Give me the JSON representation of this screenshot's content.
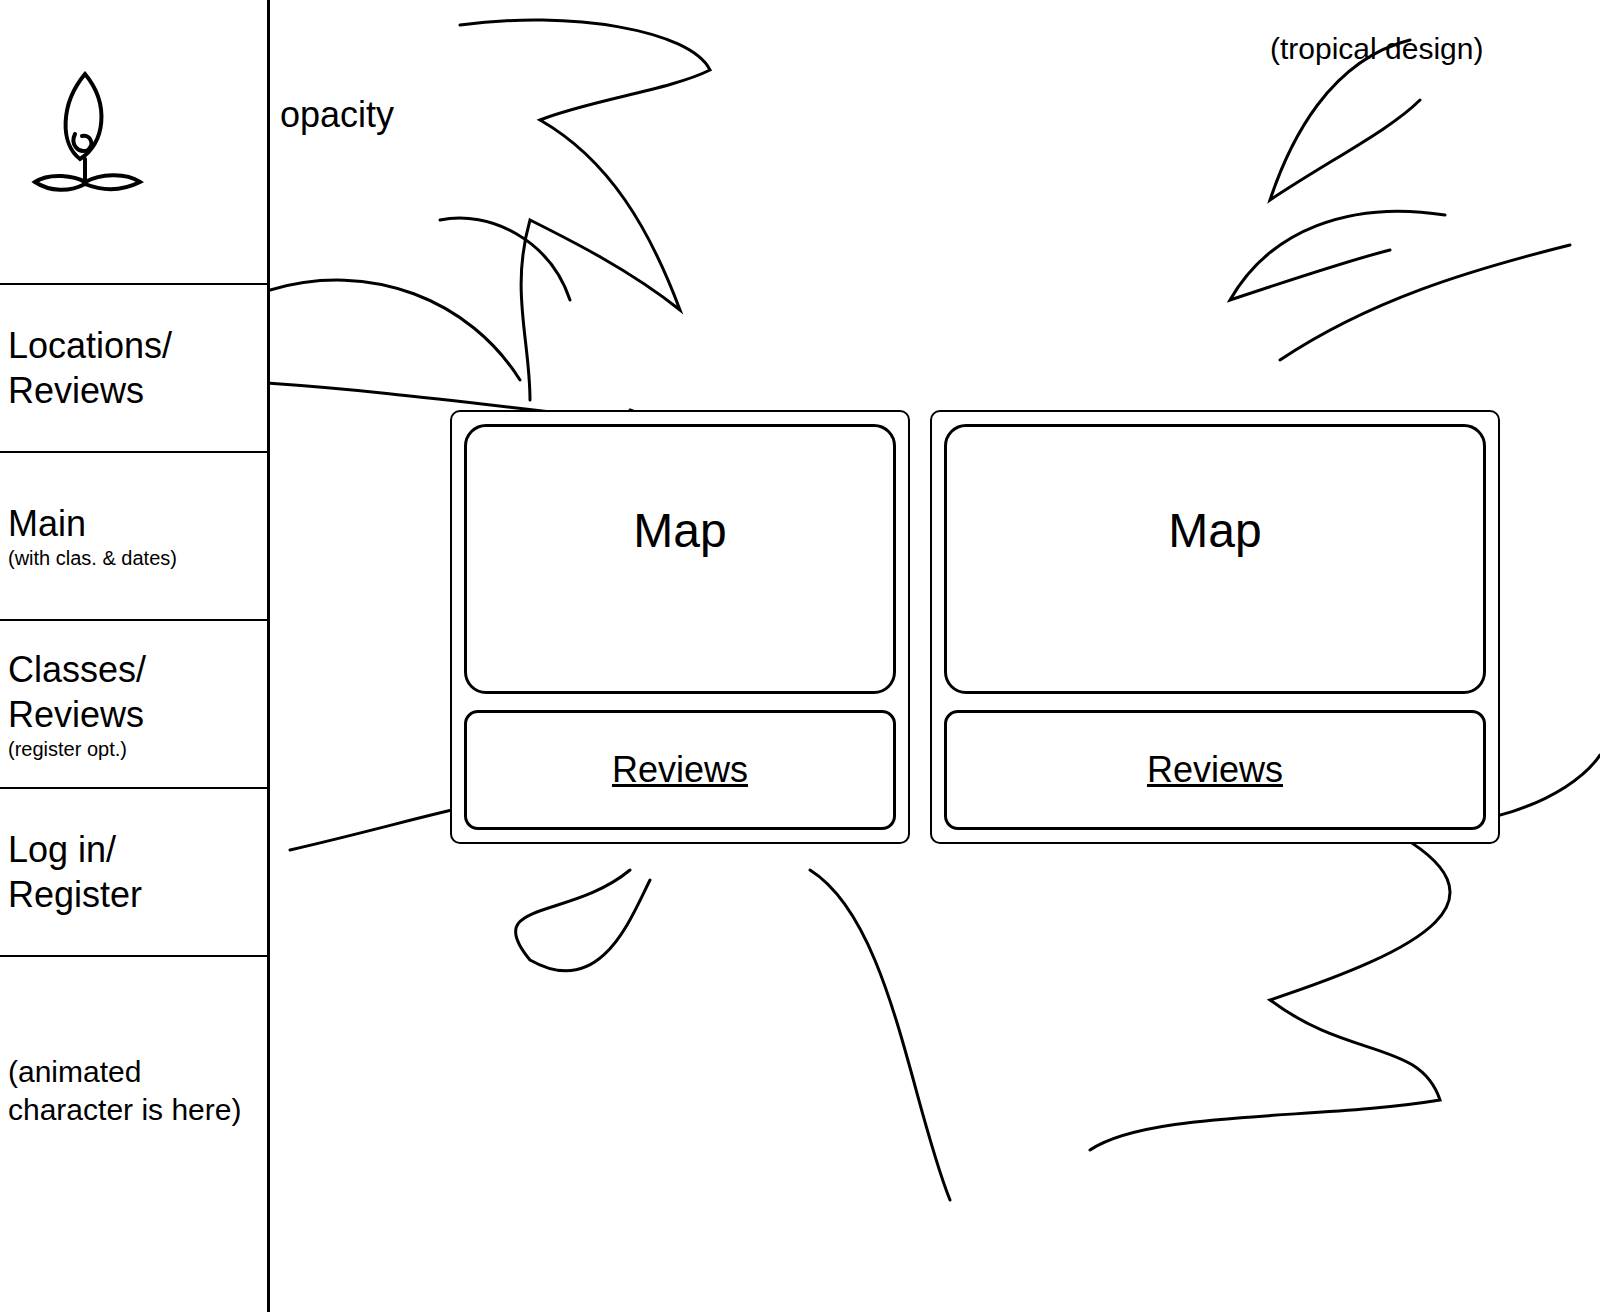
{
  "sidebar": {
    "items": [
      {
        "label": "Locations/ Reviews",
        "note": ""
      },
      {
        "label": "Main",
        "note": "(with clas. & dates)"
      },
      {
        "label": "Classes/ Reviews",
        "note": "(register opt.)"
      },
      {
        "label": "Log in/ Register",
        "note": ""
      }
    ],
    "footer": "(animated character is here)"
  },
  "annotations": {
    "sidebar_note": "opacity",
    "theme_note": "(tropical design)"
  },
  "cards": [
    {
      "map": "Map",
      "reviews": "Reviews"
    },
    {
      "map": "Map",
      "reviews": "Reviews"
    }
  ]
}
